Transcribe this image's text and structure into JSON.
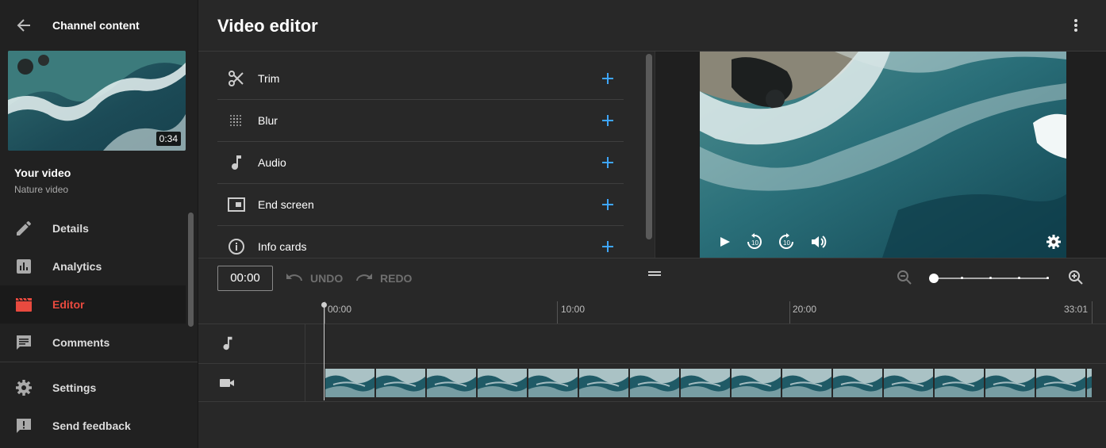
{
  "sidebar": {
    "title": "Channel content",
    "video": {
      "heading": "Your video",
      "name": "Nature video",
      "duration": "0:34"
    },
    "nav": [
      {
        "label": "Details",
        "icon": "pencil-icon"
      },
      {
        "label": "Analytics",
        "icon": "analytics-icon"
      },
      {
        "label": "Editor",
        "icon": "editor-clapperboard-icon",
        "active": true
      },
      {
        "label": "Comments",
        "icon": "comments-icon"
      },
      {
        "label": "Settings",
        "icon": "gear-icon"
      },
      {
        "label": "Send feedback",
        "icon": "feedback-icon"
      }
    ]
  },
  "header": {
    "title": "Video editor"
  },
  "tools": [
    {
      "label": "Trim",
      "icon": "scissors-icon"
    },
    {
      "label": "Blur",
      "icon": "blur-grid-icon"
    },
    {
      "label": "Audio",
      "icon": "music-note-icon"
    },
    {
      "label": "End screen",
      "icon": "end-screen-icon"
    },
    {
      "label": "Info cards",
      "icon": "info-icon"
    }
  ],
  "timeline": {
    "current_time": "00:00",
    "undo_label": "UNDO",
    "redo_label": "REDO",
    "ticks": [
      "00:00",
      "10:00",
      "20:00",
      "33:01"
    ]
  },
  "colors": {
    "accent_blue": "#3ea6ff",
    "active_red": "#e94a3f",
    "background": "#282828",
    "sidebar": "#212121"
  }
}
